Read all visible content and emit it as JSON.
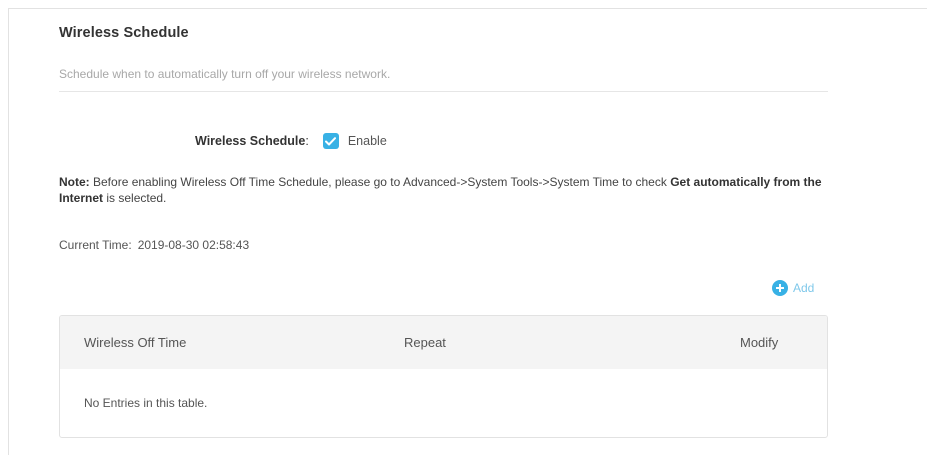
{
  "section": {
    "title": "Wireless Schedule",
    "description": "Schedule when to automatically turn off your wireless network."
  },
  "schedule": {
    "label": "Wireless Schedule",
    "colon": ":",
    "enable_label": "Enable",
    "enabled": true
  },
  "note": {
    "prefix": "Note:",
    "text_1": " Before enabling Wireless Off Time Schedule, please go to Advanced->System Tools->System Time to check ",
    "emphasis": "Get automatically from the Internet",
    "text_2": " is selected."
  },
  "current_time": {
    "label": "Current Time:",
    "value": "2019-08-30 02:58:43"
  },
  "add_button": {
    "label": "Add",
    "icon": "plus-circle-icon"
  },
  "table": {
    "columns": [
      "Wireless Off Time",
      "Repeat",
      "Modify"
    ],
    "empty_message": "No Entries in this table."
  },
  "colors": {
    "accent": "#38b1e5",
    "add_text": "#7fc8ea",
    "header_bg": "#f4f4f4"
  }
}
